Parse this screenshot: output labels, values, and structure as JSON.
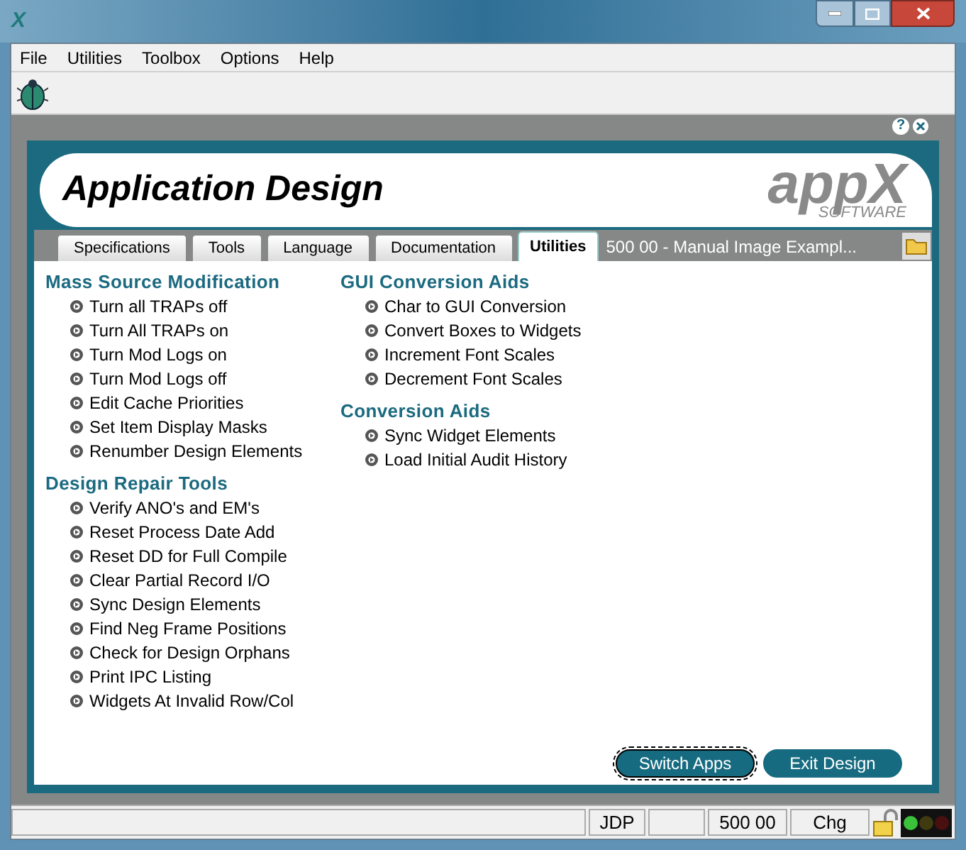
{
  "window": {
    "title_icon": "X"
  },
  "menu": [
    "File",
    "Utilities",
    "Toolbox",
    "Options",
    "Help"
  ],
  "header": {
    "title": "Application Design",
    "logo": "appX",
    "logo_sub": "SOFTWARE"
  },
  "tabs": [
    {
      "label": "Specifications",
      "selected": false
    },
    {
      "label": "Tools",
      "selected": false
    },
    {
      "label": "Language",
      "selected": false
    },
    {
      "label": "Documentation",
      "selected": false
    },
    {
      "label": "Utilities",
      "selected": true
    }
  ],
  "path": "500 00 - Manual Image Exampl...",
  "columns": [
    [
      {
        "heading": "Mass Source Modification",
        "items": [
          "Turn all TRAPs off",
          "Turn All TRAPs on",
          "Turn Mod Logs on",
          "Turn Mod Logs off",
          "Edit Cache Priorities",
          "Set Item Display Masks",
          "Renumber Design Elements"
        ]
      },
      {
        "heading": "Design Repair Tools",
        "items": [
          "Verify ANO's and EM's",
          "Reset Process Date Add",
          "Reset DD for Full Compile",
          "Clear Partial Record I/O",
          "Sync Design Elements",
          "Find Neg Frame Positions",
          "Check for Design Orphans",
          "Print IPC Listing",
          "Widgets At Invalid Row/Col"
        ]
      }
    ],
    [
      {
        "heading": "GUI Conversion Aids",
        "items": [
          "Char to GUI Conversion",
          "Convert Boxes to Widgets",
          "Increment Font Scales",
          "Decrement Font Scales"
        ]
      },
      {
        "heading": "Conversion Aids",
        "items": [
          "Sync Widget Elements",
          "Load Initial Audit History"
        ]
      }
    ]
  ],
  "buttons": [
    {
      "label": "Switch Apps",
      "focused": true
    },
    {
      "label": "Exit Design",
      "focused": false
    }
  ],
  "help_glyph": "?",
  "status_bar": [
    {
      "kind": "blank"
    },
    {
      "kind": "text",
      "text": "JDP"
    },
    {
      "kind": "blank"
    },
    {
      "kind": "text",
      "text": "500 00"
    },
    {
      "kind": "text",
      "text": "Chg"
    }
  ]
}
